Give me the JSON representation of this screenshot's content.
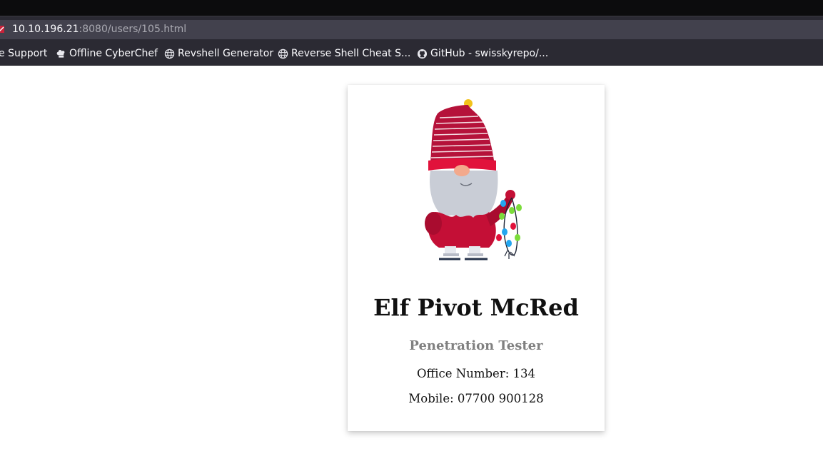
{
  "browser": {
    "url_host": "10.10.196.21",
    "url_rest": ":8080/users/105.html",
    "bookmarks": [
      {
        "label": "e Support",
        "icon": "support-icon"
      },
      {
        "label": "Offline CyberChef",
        "icon": "chef-hat-icon"
      },
      {
        "label": "Revshell Generator",
        "icon": "globe-icon"
      },
      {
        "label": "Reverse Shell Cheat S...",
        "icon": "globe-icon"
      },
      {
        "label": "GitHub - swisskyrepo/...",
        "icon": "github-icon"
      }
    ]
  },
  "profile": {
    "image": "gnome-elf-with-lights",
    "name": "Elf Pivot McRed",
    "title": "Penetration Tester",
    "office": "Office Number: 134",
    "mobile": "Mobile: 07700 900128"
  },
  "colors": {
    "hat_red": "#b5123a",
    "accent_red": "#e1123b"
  }
}
